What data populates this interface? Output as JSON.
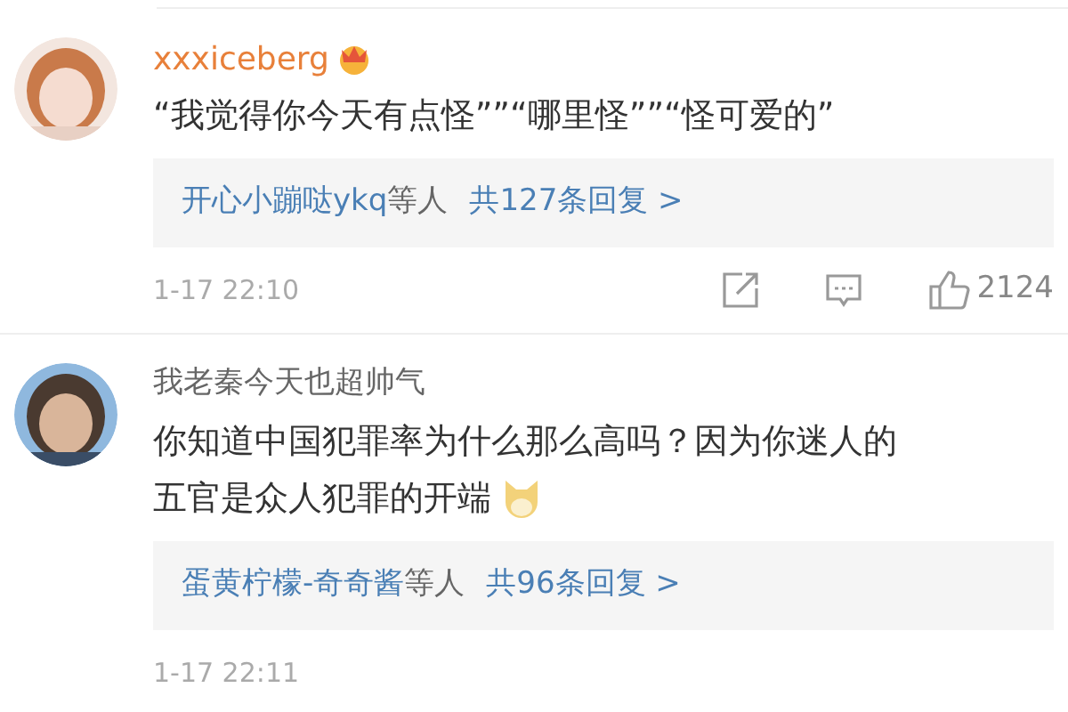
{
  "comments": [
    {
      "username": "xxxiceberg",
      "vip": true,
      "badge": true,
      "text": [
        "“我觉得你今天有点怪””“哪里怪””“怪可爱的”"
      ],
      "replies": {
        "names": "开心小蹦哒ykq",
        "suffix": "等人",
        "count": "共127条回复 >"
      },
      "time": "1-17 22:10",
      "actions": {
        "likes": "2124"
      }
    },
    {
      "username": "我老秦今天也超帅气",
      "vip": false,
      "text": [
        "你知道中国犯罪率为什么那么高吗？因为你迷人的",
        "五官是众人犯罪的开端"
      ],
      "emoji": true,
      "replies": {
        "names": "蛋黄柠檬-奇奇酱",
        "suffix": "等人",
        "count": "共96条回复 >"
      },
      "time": "1-17 22:11"
    }
  ]
}
